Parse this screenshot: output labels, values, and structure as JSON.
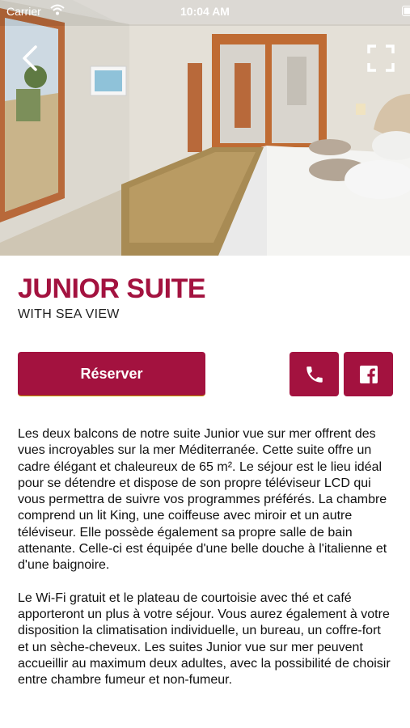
{
  "status_bar": {
    "carrier": "Carrier",
    "time": "10:04 AM"
  },
  "icons": {
    "back": "chevron-left-icon",
    "fullscreen": "expand-icon",
    "phone": "phone-icon",
    "facebook": "facebook-icon",
    "wifi": "wifi-icon",
    "battery": "battery-icon"
  },
  "room": {
    "title": "JUNIOR SUITE",
    "subtitle": "WITH SEA VIEW"
  },
  "actions": {
    "reserve_label": "Réserver"
  },
  "description": {
    "paragraph_1": "Les deux balcons de notre suite Junior vue sur mer offrent des vues incroyables sur la mer Méditerranée. Cette suite offre un cadre élégant et chaleureux de 65 m². Le séjour est le lieu idéal pour se détendre et dispose de son propre téléviseur LCD qui vous permettra de suivre vos programmes préférés. La chambre comprend un lit King, une coiffeuse avec miroir et un autre téléviseur. Elle possède également sa propre salle de bain attenante. Celle-ci est équipée d'une belle douche à l'italienne et d'une baignoire.",
    "paragraph_2": "Le Wi-Fi gratuit et le plateau de courtoisie avec thé et café apporteront un plus à votre séjour. Vous aurez également à votre disposition la climatisation individuelle, un bureau, un coffre-fort et un sèche-cheveux. Les suites Junior vue sur mer peuvent accueillir au maximum deux adultes, avec la possibilité de choisir entre chambre fumeur et non-fumeur."
  },
  "colors": {
    "brand": "#a3123f",
    "text": "#111111"
  }
}
